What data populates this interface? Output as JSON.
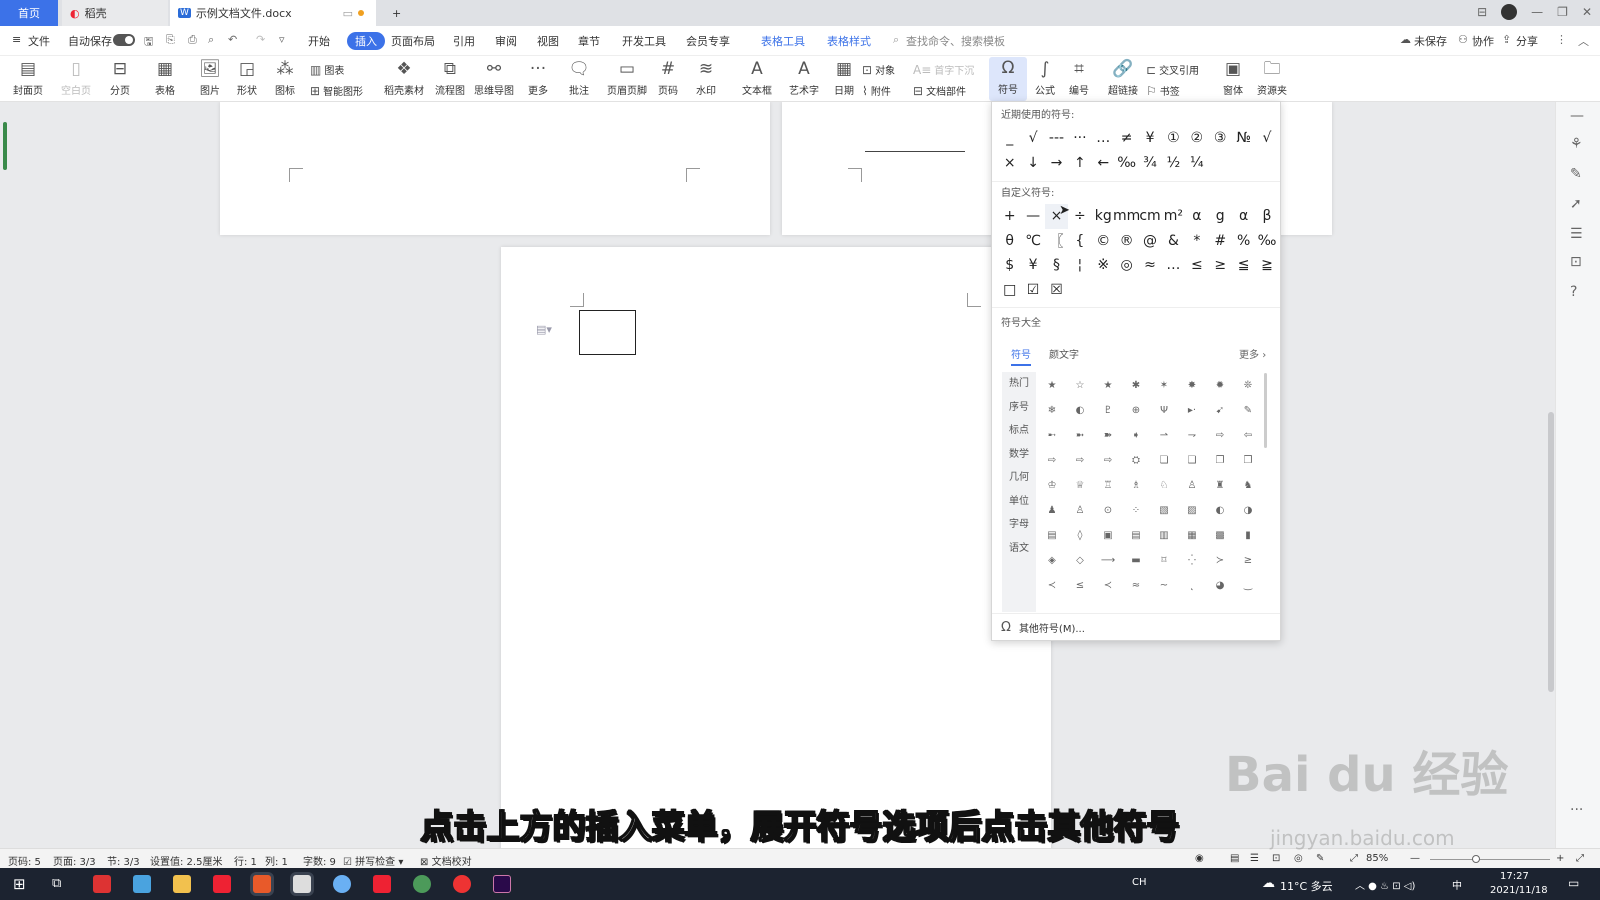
{
  "tabs": {
    "home": "首页",
    "daoke": "稻壳",
    "doc": "示例文档文件.docx",
    "new_tab": "+"
  },
  "menu": {
    "file": "文件",
    "autosave": "自动保存",
    "items": [
      "开始",
      "插入",
      "页面布局",
      "引用",
      "审阅",
      "视图",
      "章节",
      "开发工具",
      "会员专享"
    ],
    "active": "插入",
    "table_tools": "表格工具",
    "table_style": "表格样式",
    "search": "查找命令、搜索模板",
    "unsaved": "未保存",
    "collab": "协作",
    "share": "分享"
  },
  "ribbon": {
    "cover": "封面页",
    "blank": "空白页",
    "break": "分页",
    "table": "表格",
    "picture": "图片",
    "shape": "形状",
    "icon": "图标",
    "chart": "图表",
    "smartart": "智能图形",
    "daoke_material": "稻壳素材",
    "flowchart": "流程图",
    "mindmap": "思维导图",
    "more": "更多",
    "comment": "批注",
    "header_footer": "页眉页脚",
    "page_num": "页码",
    "watermark": "水印",
    "textbox": "文本框",
    "wordart": "艺术字",
    "date": "日期",
    "object": "对象",
    "attachment": "附件",
    "drop_cap": "首字下沉",
    "doc_parts": "文档部件",
    "symbol": "符号",
    "formula": "公式",
    "numbering": "编号",
    "hyperlink": "超链接",
    "cross_ref": "交叉引用",
    "bookmark": "书签",
    "font": "窗体",
    "resources": "资源夹"
  },
  "symbol_panel": {
    "recent_title": "近期使用的符号:",
    "recent": [
      "_",
      "√",
      "---",
      "···",
      "…",
      "≠",
      "¥",
      "①",
      "②",
      "③",
      "№",
      "√",
      "×",
      "↓",
      "→",
      "↑",
      "←",
      "‰",
      "¾",
      "½",
      "¼"
    ],
    "custom_title": "自定义符号:",
    "custom": [
      "+",
      "—",
      "×",
      "÷",
      "kg",
      "mm",
      "cm",
      "m²",
      "α",
      "g",
      "α",
      "β",
      "θ",
      "℃",
      "〖",
      "{",
      "©",
      "®",
      "@",
      "&",
      "*",
      "#",
      "%",
      "‰",
      "$",
      "¥",
      "§",
      "¦",
      "※",
      "◎",
      "≈",
      "…",
      "≤",
      "≥",
      "≦",
      "≧",
      "□",
      "☑",
      "☒"
    ],
    "library_title": "符号大全",
    "lib_tabs": [
      "符号",
      "颜文字"
    ],
    "more": "更多",
    "categories": [
      "热门",
      "序号",
      "标点",
      "数学",
      "几何",
      "单位",
      "字母",
      "语文"
    ],
    "library": [
      "★",
      "☆",
      "★",
      "✱",
      "✶",
      "✸",
      "✹",
      "❊",
      "❄",
      "◐",
      "♇",
      "⊕",
      "Ψ",
      "▸·",
      "➹",
      "✎",
      "➸",
      "➼",
      "➽",
      "➧",
      "⇀",
      "⇁",
      "⇨",
      "⇦",
      "⇨",
      "⇨",
      "⇨",
      "⛭",
      "❏",
      "❑",
      "❐",
      "❒",
      "♔",
      "♕",
      "♖",
      "♗",
      "♘",
      "♙",
      "♜",
      "♞",
      "♟",
      "♙",
      "⊙",
      "⁘",
      "▧",
      "▨",
      "◐",
      "◑",
      "▤",
      "◊",
      "▣",
      "▤",
      "▥",
      "▦",
      "▩",
      "▮",
      "◈",
      "◇",
      "⟶",
      "▬",
      "⌑",
      "⁛",
      "≻",
      "≥",
      "≺",
      "≤",
      "≺",
      "≈",
      "~",
      "˛",
      "◕",
      "‿"
    ],
    "other": "其他符号(M)..."
  },
  "status": {
    "page_code": "页码: 5",
    "page": "页面: 3/3",
    "section": "节: 3/3",
    "setting": "设置值: 2.5厘米",
    "row": "行: 1",
    "col": "列: 1",
    "words": "字数: 9",
    "spell": "拼写检查",
    "proof": "文档校对",
    "zoom": "85%"
  },
  "subtitle": "点击上方的插入菜单，展开符号选项后点击其他符号",
  "watermark": "Bai du 经验",
  "watermark_url": "jingyan.baidu.com",
  "taskbar": {
    "weather": "11°C 多云",
    "time": "17:27",
    "date": "2021/11/18",
    "ime": "中"
  }
}
